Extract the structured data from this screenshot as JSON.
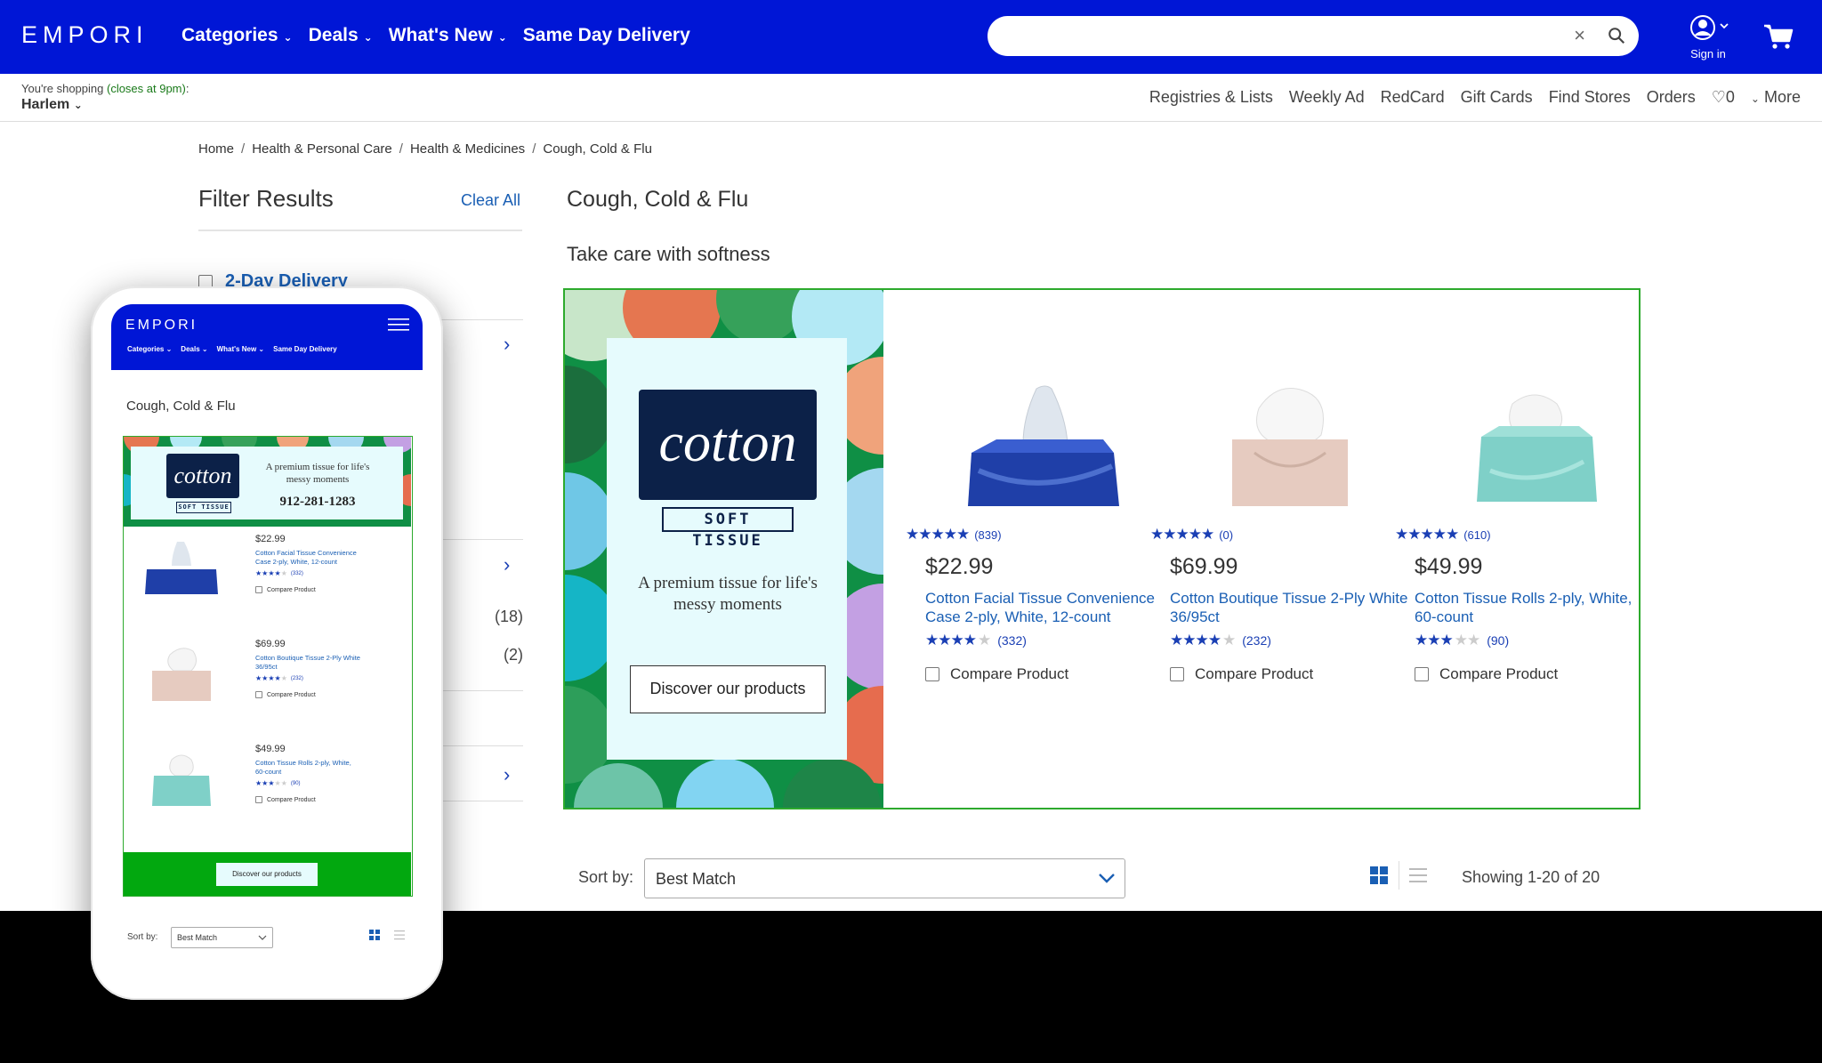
{
  "header": {
    "logo": "EMPORI",
    "nav": [
      {
        "label": "Categories",
        "has_caret": true
      },
      {
        "label": "Deals",
        "has_caret": true
      },
      {
        "label": "What's New",
        "has_caret": true
      },
      {
        "label": "Same Day Delivery",
        "has_caret": false
      }
    ],
    "search": {
      "value": "",
      "placeholder": ""
    },
    "sign_in": "Sign in"
  },
  "subbar": {
    "shopping_prefix": "You're shopping ",
    "store_hours": "(closes at 9pm)",
    "shopping_suffix": ":",
    "store_name": "Harlem",
    "links": [
      "Registries & Lists",
      "Weekly Ad",
      "RedCard",
      "Gift Cards",
      "Find Stores",
      "Orders"
    ],
    "favorites_count": "0",
    "more": "More"
  },
  "breadcrumb": [
    "Home",
    "Health & Personal Care",
    "Health & Medicines",
    "Cough, Cold & Flu"
  ],
  "filters": {
    "title": "Filter Results",
    "clear_all": "Clear All",
    "two_day": "2-Day Delivery",
    "counts": [
      "(18)",
      "(2)"
    ]
  },
  "main": {
    "title": "Cough, Cold & Flu",
    "subtitle": "Take care with softness"
  },
  "promo": {
    "brand": "cotton",
    "brand_sub": "SOFT TISSUE",
    "tagline": "A premium tissue for life's messy moments",
    "cta": "Discover our products",
    "phone": "912-281-1283"
  },
  "products": [
    {
      "top_rating": 5,
      "top_reviews": "(839)",
      "price": "$22.99",
      "title": "Cotton Facial Tissue Convenience Case 2-ply, White, 12-count",
      "rating": 4.5,
      "reviews": "(332)",
      "compare": "Compare Product",
      "box_color": "#1f3fa8"
    },
    {
      "top_rating": 5,
      "top_reviews": "(0)",
      "price": "$69.99",
      "title": "Cotton Boutique Tissue 2-Ply White 36/95ct",
      "rating": 4.5,
      "reviews": "(232)",
      "compare": "Compare Product",
      "box_color": "#e3c9be"
    },
    {
      "top_rating": 5,
      "top_reviews": "(610)",
      "price": "$49.99",
      "title": "Cotton Tissue Rolls 2-ply, White, 60-count",
      "rating": 3,
      "reviews": "(90)",
      "compare": "Compare Product",
      "box_color": "#7fd0c8"
    }
  ],
  "sort": {
    "label": "Sort by:",
    "selected": "Best Match",
    "showing": "Showing 1-20 of 20"
  },
  "mobile": {
    "logo": "EMPORI",
    "nav": [
      "Categories",
      "Deals",
      "What's New",
      "Same Day Delivery"
    ],
    "title": "Cough, Cold & Flu",
    "brand": "cotton",
    "brand_sub": "SOFT TISSUE",
    "tagline": "A premium tissue for life's messy moments",
    "phone": "912-281-1283",
    "products": [
      {
        "price": "$22.99",
        "title": "Cotton Facial Tissue Convenience Case 2-ply, White, 12-count",
        "reviews": "(332)",
        "compare": "Compare Product"
      },
      {
        "price": "$69.99",
        "title": "Cotton Boutique Tissue 2-Ply White 36/95ct",
        "reviews": "(232)",
        "compare": "Compare Product"
      },
      {
        "price": "$49.99",
        "title": "Cotton Tissue Rolls 2-ply, White, 60-count",
        "reviews": "(90)",
        "compare": "Compare Product"
      }
    ],
    "cta": "Discover our products",
    "sort_label": "Sort by:",
    "sort_selected": "Best Match"
  },
  "colors": {
    "brand_blue": "#0016d6",
    "link_blue": "#1a5fb4",
    "promo_green": "#2daa2d",
    "cotton_navy": "#0c2148"
  }
}
